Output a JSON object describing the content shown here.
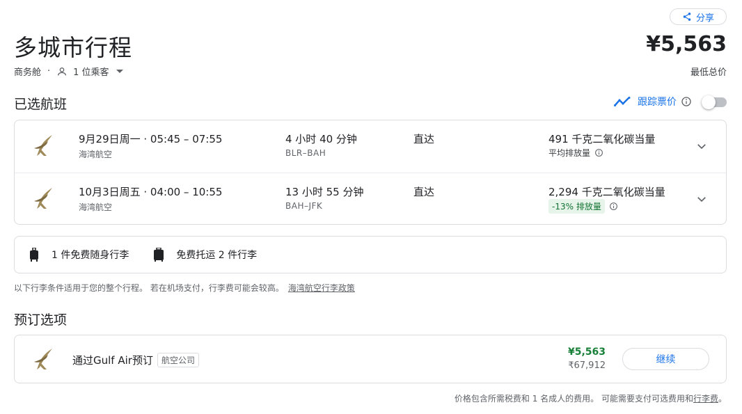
{
  "header": {
    "share_label": "分享",
    "title": "多城市行程",
    "cabin": "商务舱",
    "separator": "·",
    "passengers": "1 位乘客",
    "total_price": "¥5,563",
    "price_label": "最低总价"
  },
  "selected": {
    "section_title": "已选航班",
    "track_label": "跟踪票价",
    "track_enabled": false,
    "flights": [
      {
        "datetime": "9月29日周一 · 05:45 – 07:55",
        "airline": "海湾航空",
        "duration": "4 小时 40 分钟",
        "route": "BLR–BAH",
        "stops": "直达",
        "emissions": "491 千克二氧化碳当量",
        "emissions_note": "平均排放量",
        "emissions_badge": ""
      },
      {
        "datetime": "10月3日周五 · 04:00 – 10:55",
        "airline": "海湾航空",
        "duration": "13 小时 55 分钟",
        "route": "BAH–JFK",
        "stops": "直达",
        "emissions": "2,294 千克二氧化碳当量",
        "emissions_note": "",
        "emissions_badge": "-13% 排放量"
      }
    ]
  },
  "baggage": {
    "carry_on": "1 件免费随身行李",
    "checked": "免费托运 2 件行李",
    "note": "以下行李条件适用于您的整个行程。 若在机场支付，行李费可能会较高。",
    "policy_link": "海湾航空行李政策"
  },
  "booking": {
    "section_title": "预订选项",
    "via": "通过Gulf Air预订",
    "tag": "航空公司",
    "price": "¥5,563",
    "price_alt": "₹67,912",
    "continue_label": "继续"
  },
  "footer": {
    "note": "价格包含所需税费和 1 名成人的费用。 可能需要支付可选费用和",
    "link": "行李费",
    "end": "。"
  },
  "colors": {
    "accent": "#1a73e8",
    "price_green": "#188038",
    "badge_bg": "#e6f4ea",
    "logo_gold": "#a08a5a"
  }
}
